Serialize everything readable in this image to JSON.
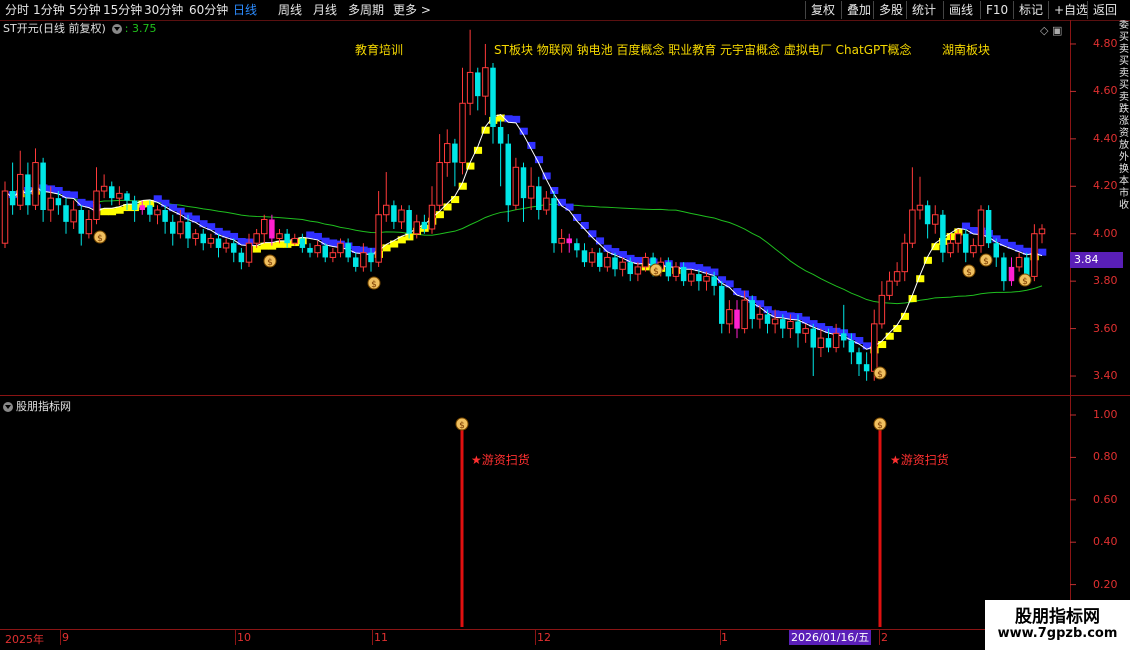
{
  "toolbar": {
    "periods": [
      "分时",
      "1分钟",
      "5分钟",
      "15分钟",
      "30分钟",
      "60分钟",
      "日线",
      "周线",
      "月线",
      "多周期",
      "更多 >"
    ],
    "active_period": "日线",
    "right_buttons": [
      "复权",
      "叠加",
      "多股",
      "统计",
      "画线",
      "F10",
      "标记",
      "+自选",
      "返回"
    ]
  },
  "stock": {
    "name": "ST开元(日线 前复权)",
    "ver_label": ": 3.75"
  },
  "concepts": [
    {
      "text": "教育培训"
    },
    {
      "text": "ST板块 物联网 钠电池 百度概念 职业教育 元宇宙概念 虚拟电厂 ChatGPT概念"
    },
    {
      "text": "湖南板块"
    }
  ],
  "price_axis": {
    "ticks": [
      "4.80",
      "4.60",
      "4.40",
      "4.20",
      "4.00",
      "3.80",
      "3.60",
      "3.40"
    ],
    "current_price": "3.84"
  },
  "indicator": {
    "title": "股朋指标网",
    "ticks": [
      "1.00",
      "0.80",
      "0.60",
      "0.40",
      "0.20"
    ],
    "signal_text": "★游资扫货"
  },
  "date_axis": {
    "labels": [
      "2025年",
      "9",
      "10",
      "11",
      "12",
      "1",
      "2"
    ],
    "cursor_date": "2026/01/16/五"
  },
  "watermark": {
    "title": "股朋指标网",
    "url": "www.7gpzb.com"
  },
  "side_strip": [
    "委",
    "买",
    "卖",
    "买",
    "卖",
    "买",
    "卖",
    "跌",
    "涨",
    "资",
    "放",
    "外",
    "换",
    "本",
    "市",
    "收"
  ],
  "colors": {
    "up": "#ff3a3a",
    "down": "#00e6e6",
    "ma_white": "#ffffff",
    "ma_blue": "#3030ff",
    "ma_yellow": "#ffff00",
    "ma_green": "#1fbf1f",
    "magenta": "#ff20d0"
  },
  "chart_data": {
    "type": "candlestick",
    "ylim": [
      3.32,
      4.88
    ],
    "candles": [
      [
        3.96,
        4.18,
        4.22,
        3.94
      ],
      [
        4.18,
        4.12,
        4.3,
        4.08
      ],
      [
        4.12,
        4.25,
        4.35,
        4.1
      ],
      [
        4.25,
        4.12,
        4.3,
        4.08
      ],
      [
        4.12,
        4.3,
        4.36,
        4.1
      ],
      [
        4.3,
        4.1,
        4.32,
        4.05
      ],
      [
        4.1,
        4.15,
        4.2,
        4.05
      ],
      [
        4.15,
        4.12,
        4.18,
        4.08
      ],
      [
        4.12,
        4.05,
        4.15,
        4.0
      ],
      [
        4.05,
        4.1,
        4.14,
        4.02
      ],
      [
        4.1,
        4.0,
        4.12,
        3.95
      ],
      [
        4.0,
        4.06,
        4.1,
        3.98
      ],
      [
        4.06,
        4.18,
        4.28,
        4.04
      ],
      [
        4.18,
        4.2,
        4.25,
        4.15
      ],
      [
        4.2,
        4.15,
        4.22,
        4.12
      ],
      [
        4.15,
        4.17,
        4.2,
        4.12
      ],
      [
        4.17,
        4.14,
        4.18,
        4.1
      ],
      [
        4.14,
        4.1,
        4.16,
        4.05
      ],
      [
        4.1,
        4.12,
        4.14,
        4.08
      ],
      [
        4.12,
        4.08,
        4.14,
        4.05
      ],
      [
        4.08,
        4.1,
        4.12,
        4.04
      ],
      [
        4.1,
        4.05,
        4.12,
        4.0
      ],
      [
        4.05,
        4.0,
        4.08,
        3.95
      ],
      [
        4.0,
        4.05,
        4.1,
        3.98
      ],
      [
        4.05,
        3.98,
        4.08,
        3.94
      ],
      [
        3.98,
        4.0,
        4.02,
        3.95
      ],
      [
        4.0,
        3.96,
        4.02,
        3.93
      ],
      [
        3.96,
        3.98,
        4.0,
        3.94
      ],
      [
        3.98,
        3.94,
        4.0,
        3.9
      ],
      [
        3.94,
        3.96,
        3.98,
        3.92
      ],
      [
        3.96,
        3.92,
        3.98,
        3.88
      ],
      [
        3.92,
        3.88,
        3.94,
        3.85
      ],
      [
        3.88,
        3.96,
        4.0,
        3.86
      ],
      [
        3.96,
        4.0,
        4.02,
        3.94
      ],
      [
        4.0,
        4.06,
        4.08,
        3.96
      ],
      [
        4.06,
        3.98,
        4.08,
        3.95
      ],
      [
        3.98,
        4.0,
        4.02,
        3.96
      ],
      [
        4.0,
        3.96,
        4.02,
        3.94
      ],
      [
        3.96,
        3.98,
        4.0,
        3.95
      ],
      [
        3.98,
        3.94,
        4.0,
        3.92
      ],
      [
        3.94,
        3.92,
        3.96,
        3.9
      ],
      [
        3.92,
        3.95,
        3.97,
        3.9
      ],
      [
        3.95,
        3.9,
        3.96,
        3.88
      ],
      [
        3.9,
        3.92,
        3.94,
        3.88
      ],
      [
        3.92,
        3.96,
        3.98,
        3.9
      ],
      [
        3.96,
        3.9,
        3.98,
        3.88
      ],
      [
        3.9,
        3.86,
        3.92,
        3.84
      ],
      [
        3.86,
        3.92,
        3.96,
        3.84
      ],
      [
        3.92,
        3.88,
        3.94,
        3.84
      ],
      [
        3.88,
        4.08,
        4.18,
        3.86
      ],
      [
        4.08,
        4.12,
        4.26,
        4.05
      ],
      [
        4.12,
        4.05,
        4.14,
        4.02
      ],
      [
        4.05,
        4.1,
        4.12,
        4.02
      ],
      [
        4.1,
        4.0,
        4.12,
        3.98
      ],
      [
        4.0,
        4.05,
        4.08,
        3.98
      ],
      [
        4.05,
        4.02,
        4.08,
        4.0
      ],
      [
        4.02,
        4.12,
        4.2,
        4.0
      ],
      [
        4.12,
        4.3,
        4.42,
        4.1
      ],
      [
        4.3,
        4.38,
        4.44,
        4.24
      ],
      [
        4.38,
        4.3,
        4.4,
        4.2
      ],
      [
        4.3,
        4.55,
        4.7,
        4.25
      ],
      [
        4.55,
        4.68,
        4.86,
        4.5
      ],
      [
        4.68,
        4.58,
        4.7,
        4.52
      ],
      [
        4.58,
        4.7,
        4.8,
        4.5
      ],
      [
        4.7,
        4.45,
        4.72,
        4.38
      ],
      [
        4.45,
        4.38,
        4.48,
        4.2
      ],
      [
        4.38,
        4.12,
        4.42,
        4.05
      ],
      [
        4.12,
        4.28,
        4.32,
        4.1
      ],
      [
        4.28,
        4.15,
        4.3,
        4.05
      ],
      [
        4.15,
        4.2,
        4.28,
        4.1
      ],
      [
        4.2,
        4.1,
        4.24,
        4.06
      ],
      [
        4.1,
        4.15,
        4.18,
        4.08
      ],
      [
        4.15,
        3.96,
        4.18,
        3.92
      ],
      [
        3.96,
        3.98,
        4.02,
        3.92
      ],
      [
        3.98,
        3.96,
        4.0,
        3.92
      ],
      [
        3.96,
        3.93,
        3.98,
        3.9
      ],
      [
        3.93,
        3.88,
        3.96,
        3.86
      ],
      [
        3.88,
        3.92,
        3.94,
        3.86
      ],
      [
        3.92,
        3.86,
        3.94,
        3.84
      ],
      [
        3.86,
        3.9,
        3.92,
        3.84
      ],
      [
        3.9,
        3.85,
        3.92,
        3.82
      ],
      [
        3.85,
        3.88,
        3.9,
        3.82
      ],
      [
        3.88,
        3.83,
        3.9,
        3.8
      ],
      [
        3.83,
        3.86,
        3.88,
        3.8
      ],
      [
        3.86,
        3.9,
        3.92,
        3.84
      ],
      [
        3.9,
        3.85,
        3.92,
        3.82
      ],
      [
        3.85,
        3.88,
        3.9,
        3.82
      ],
      [
        3.88,
        3.82,
        3.9,
        3.8
      ],
      [
        3.82,
        3.86,
        3.88,
        3.8
      ],
      [
        3.86,
        3.8,
        3.88,
        3.78
      ],
      [
        3.8,
        3.83,
        3.85,
        3.78
      ],
      [
        3.83,
        3.8,
        3.85,
        3.76
      ],
      [
        3.8,
        3.82,
        3.84,
        3.76
      ],
      [
        3.82,
        3.78,
        3.84,
        3.74
      ],
      [
        3.78,
        3.62,
        3.8,
        3.58
      ],
      [
        3.62,
        3.68,
        3.72,
        3.58
      ],
      [
        3.68,
        3.6,
        3.72,
        3.56
      ],
      [
        3.6,
        3.72,
        3.76,
        3.58
      ],
      [
        3.72,
        3.64,
        3.74,
        3.6
      ],
      [
        3.64,
        3.66,
        3.7,
        3.6
      ],
      [
        3.66,
        3.62,
        3.68,
        3.58
      ],
      [
        3.62,
        3.64,
        3.68,
        3.58
      ],
      [
        3.64,
        3.6,
        3.66,
        3.56
      ],
      [
        3.6,
        3.63,
        3.66,
        3.56
      ],
      [
        3.63,
        3.58,
        3.66,
        3.52
      ],
      [
        3.58,
        3.6,
        3.62,
        3.54
      ],
      [
        3.6,
        3.52,
        3.62,
        3.4
      ],
      [
        3.52,
        3.56,
        3.6,
        3.48
      ],
      [
        3.56,
        3.52,
        3.6,
        3.5
      ],
      [
        3.52,
        3.58,
        3.62,
        3.5
      ],
      [
        3.58,
        3.55,
        3.7,
        3.52
      ],
      [
        3.55,
        3.5,
        3.58,
        3.45
      ],
      [
        3.5,
        3.45,
        3.52,
        3.4
      ],
      [
        3.45,
        3.42,
        3.5,
        3.38
      ],
      [
        3.42,
        3.62,
        3.68,
        3.38
      ],
      [
        3.62,
        3.74,
        3.8,
        3.6
      ],
      [
        3.74,
        3.8,
        3.84,
        3.72
      ],
      [
        3.8,
        3.84,
        3.88,
        3.78
      ],
      [
        3.84,
        3.96,
        4.0,
        3.8
      ],
      [
        3.96,
        4.1,
        4.28,
        3.94
      ],
      [
        4.1,
        4.12,
        4.24,
        4.06
      ],
      [
        4.12,
        4.04,
        4.14,
        3.98
      ],
      [
        4.04,
        4.08,
        4.12,
        4.0
      ],
      [
        4.08,
        3.92,
        4.1,
        3.88
      ],
      [
        3.92,
        3.96,
        4.0,
        3.9
      ],
      [
        3.96,
        4.0,
        4.02,
        3.92
      ],
      [
        4.0,
        3.92,
        4.02,
        3.88
      ],
      [
        3.92,
        3.95,
        3.98,
        3.9
      ],
      [
        3.95,
        4.1,
        4.12,
        3.92
      ],
      [
        4.1,
        3.96,
        4.12,
        3.94
      ],
      [
        3.96,
        3.9,
        3.98,
        3.86
      ],
      [
        3.9,
        3.8,
        3.92,
        3.76
      ],
      [
        3.8,
        3.86,
        3.9,
        3.78
      ],
      [
        3.86,
        3.9,
        3.92,
        3.84
      ],
      [
        3.9,
        3.82,
        3.92,
        3.8
      ],
      [
        3.82,
        4.0,
        4.04,
        3.8
      ],
      [
        4.0,
        4.02,
        4.04,
        3.96
      ]
    ],
    "signal_markers": [
      "rank-1",
      "rank-2"
    ]
  }
}
